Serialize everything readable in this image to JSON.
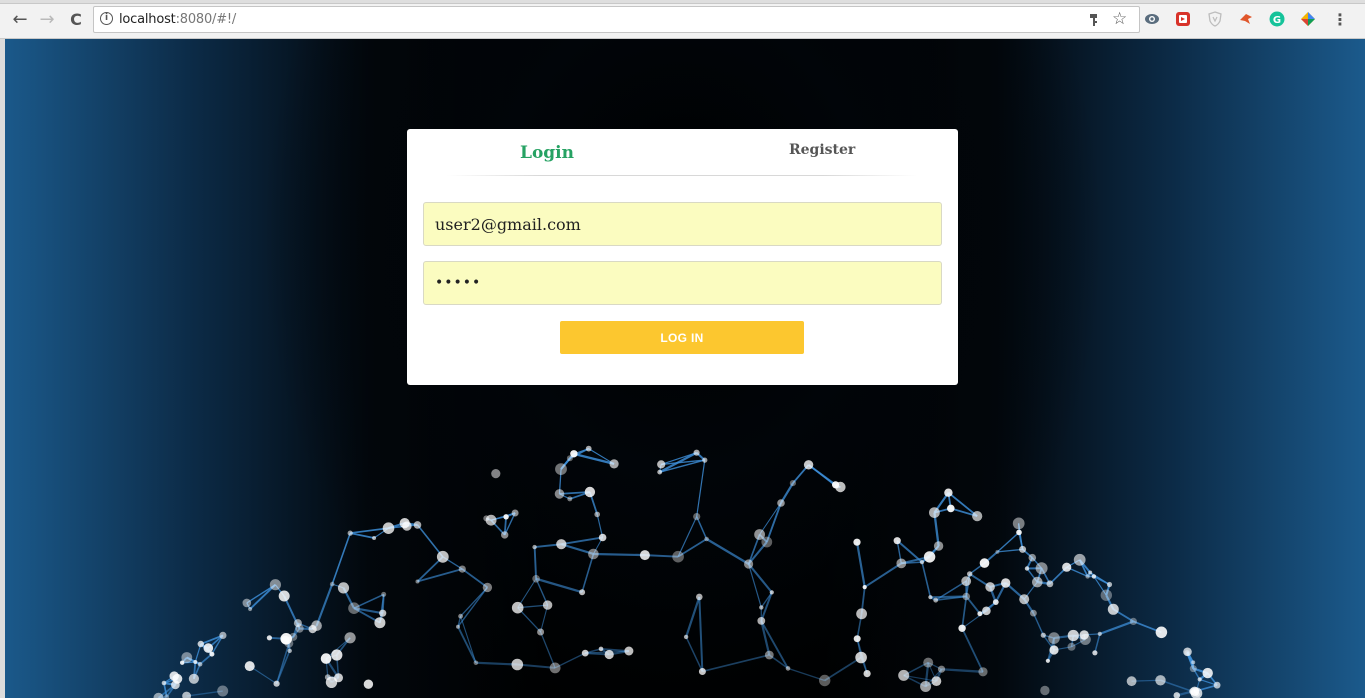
{
  "browser": {
    "url_host": "localhost",
    "url_rest": ":8080/#!/",
    "back_glyph": "←",
    "forward_glyph": "→",
    "reload_glyph": "C",
    "icons": [
      "info-icon",
      "key-icon",
      "star-icon",
      "eye-extension-icon",
      "video-extension-icon",
      "shield-extension-icon",
      "rocket-extension-icon",
      "grammarly-extension-icon",
      "color-extension-icon",
      "menu-icon"
    ]
  },
  "login_card": {
    "tabs": {
      "login": "Login",
      "register": "Register"
    },
    "email_value": "user2@gmail.com",
    "password_value": "•••••",
    "login_button": "LOG IN"
  },
  "colors": {
    "accent_green": "#26a263",
    "button_yellow": "#fcc72f",
    "autofill_yellow": "#fbfcc0"
  }
}
